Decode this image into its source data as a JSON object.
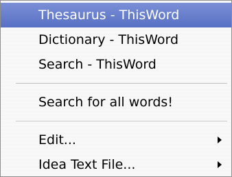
{
  "menu": {
    "items": [
      {
        "label": "Thesaurus - ThisWord"
      },
      {
        "label": "Dictionary - ThisWord"
      },
      {
        "label": "Search - ThisWord"
      },
      {
        "label": "Search for all words!"
      },
      {
        "label": "Edit..."
      },
      {
        "label": "Idea Text File..."
      }
    ],
    "highlight_color": "#5f78cb",
    "submenu_arrow_icon": "triangle-right-icon"
  }
}
